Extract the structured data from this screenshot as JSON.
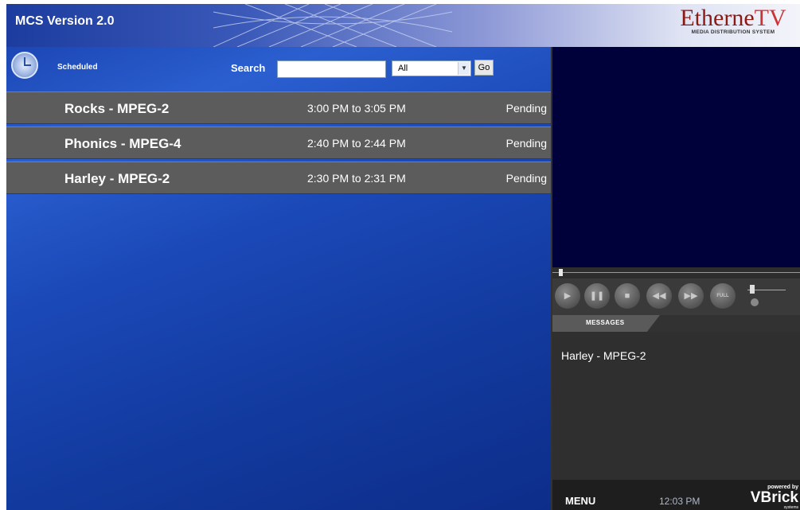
{
  "header": {
    "app_title": "MCS Version 2.0",
    "logo_word": "Etherne",
    "logo_word_tv": "TV",
    "logo_sub": "MEDIA DISTRIBUTION SYSTEM"
  },
  "toolbar": {
    "scheduled_label": "Scheduled",
    "search_label": "Search",
    "search_value": "",
    "filter_value": "All",
    "go_label": "Go"
  },
  "schedule": [
    {
      "name": "Rocks - MPEG-2",
      "time": "3:00 PM to 3:05 PM",
      "status": "Pending"
    },
    {
      "name": "Phonics - MPEG-4",
      "time": "2:40 PM to 2:44 PM",
      "status": "Pending"
    },
    {
      "name": "Harley - MPEG-2",
      "time": "2:30 PM to 2:31 PM",
      "status": "Pending"
    }
  ],
  "player": {
    "buttons": [
      "play",
      "pause",
      "stop",
      "rewind",
      "fast-forward",
      "full"
    ],
    "full_label": "FULL"
  },
  "messages": {
    "tab_label": "MESSAGES",
    "text": "Harley - MPEG-2"
  },
  "footer": {
    "menu_label": "MENU",
    "time": "12:03 PM",
    "powered_by": "powered by",
    "brand": "VBrick",
    "brand_sub": "systems"
  }
}
